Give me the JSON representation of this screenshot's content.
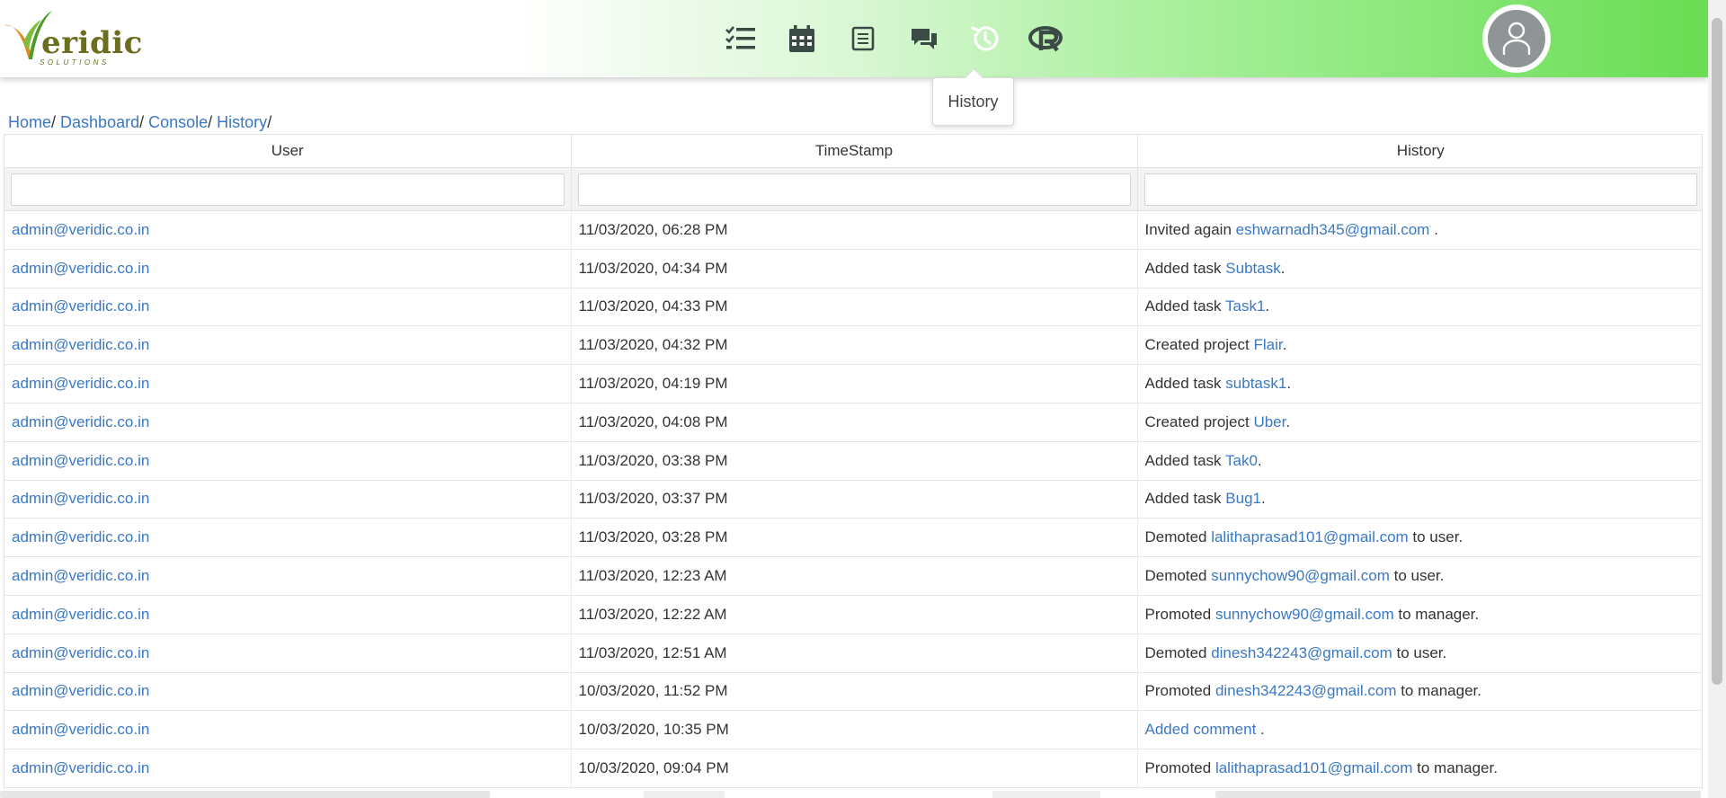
{
  "logo": {
    "text": "eridic",
    "sub": "SOLUTIONS"
  },
  "nav": {
    "icons": [
      "tasks-list-icon",
      "calendar-icon",
      "notes-icon",
      "chat-icon",
      "history-icon",
      "r-logo-icon"
    ],
    "tooltip": "History"
  },
  "breadcrumb": [
    {
      "label": "Home"
    },
    {
      "label": "Dashboard"
    },
    {
      "label": "Console"
    },
    {
      "label": "History"
    }
  ],
  "table": {
    "headers": [
      "User",
      "TimeStamp",
      "History"
    ],
    "rows": [
      {
        "user": "admin@veridic.co.in",
        "time": "11/03/2020, 06:28 PM",
        "pre": "Invited again ",
        "link": "eshwarnadh345@gmail.com",
        "post": " ."
      },
      {
        "user": "admin@veridic.co.in",
        "time": "11/03/2020, 04:34 PM",
        "pre": "Added task ",
        "link": "Subtask",
        "post": "."
      },
      {
        "user": "admin@veridic.co.in",
        "time": "11/03/2020, 04:33 PM",
        "pre": "Added task ",
        "link": "Task1",
        "post": "."
      },
      {
        "user": "admin@veridic.co.in",
        "time": "11/03/2020, 04:32 PM",
        "pre": "Created project ",
        "link": "Flair",
        "post": "."
      },
      {
        "user": "admin@veridic.co.in",
        "time": "11/03/2020, 04:19 PM",
        "pre": "Added task ",
        "link": "subtask1",
        "post": "."
      },
      {
        "user": "admin@veridic.co.in",
        "time": "11/03/2020, 04:08 PM",
        "pre": "Created project ",
        "link": "Uber",
        "post": "."
      },
      {
        "user": "admin@veridic.co.in",
        "time": "11/03/2020, 03:38 PM",
        "pre": "Added task ",
        "link": "Tak0",
        "post": "."
      },
      {
        "user": "admin@veridic.co.in",
        "time": "11/03/2020, 03:37 PM",
        "pre": "Added task ",
        "link": "Bug1",
        "post": "."
      },
      {
        "user": "admin@veridic.co.in",
        "time": "11/03/2020, 03:28 PM",
        "pre": "Demoted ",
        "link": "lalithaprasad101@gmail.com",
        "post": " to user."
      },
      {
        "user": "admin@veridic.co.in",
        "time": "11/03/2020, 12:23 AM",
        "pre": "Demoted ",
        "link": "sunnychow90@gmail.com",
        "post": " to user."
      },
      {
        "user": "admin@veridic.co.in",
        "time": "11/03/2020, 12:22 AM",
        "pre": "Promoted ",
        "link": "sunnychow90@gmail.com",
        "post": " to manager."
      },
      {
        "user": "admin@veridic.co.in",
        "time": "11/03/2020, 12:51 AM",
        "pre": "Demoted ",
        "link": "dinesh342243@gmail.com",
        "post": " to user."
      },
      {
        "user": "admin@veridic.co.in",
        "time": "10/03/2020, 11:52 PM",
        "pre": "Promoted ",
        "link": "dinesh342243@gmail.com",
        "post": " to manager."
      },
      {
        "user": "admin@veridic.co.in",
        "time": "10/03/2020, 10:35 PM",
        "pre": "",
        "link": "Added comment",
        "post": " ."
      },
      {
        "user": "admin@veridic.co.in",
        "time": "10/03/2020, 09:04 PM",
        "pre": "Promoted ",
        "link": "lalithaprasad101@gmail.com",
        "post": " to manager."
      }
    ]
  },
  "colors": {
    "link": "#3a78c3",
    "accent_green": "#69dd53",
    "icon_dark": "#3b4a45"
  }
}
